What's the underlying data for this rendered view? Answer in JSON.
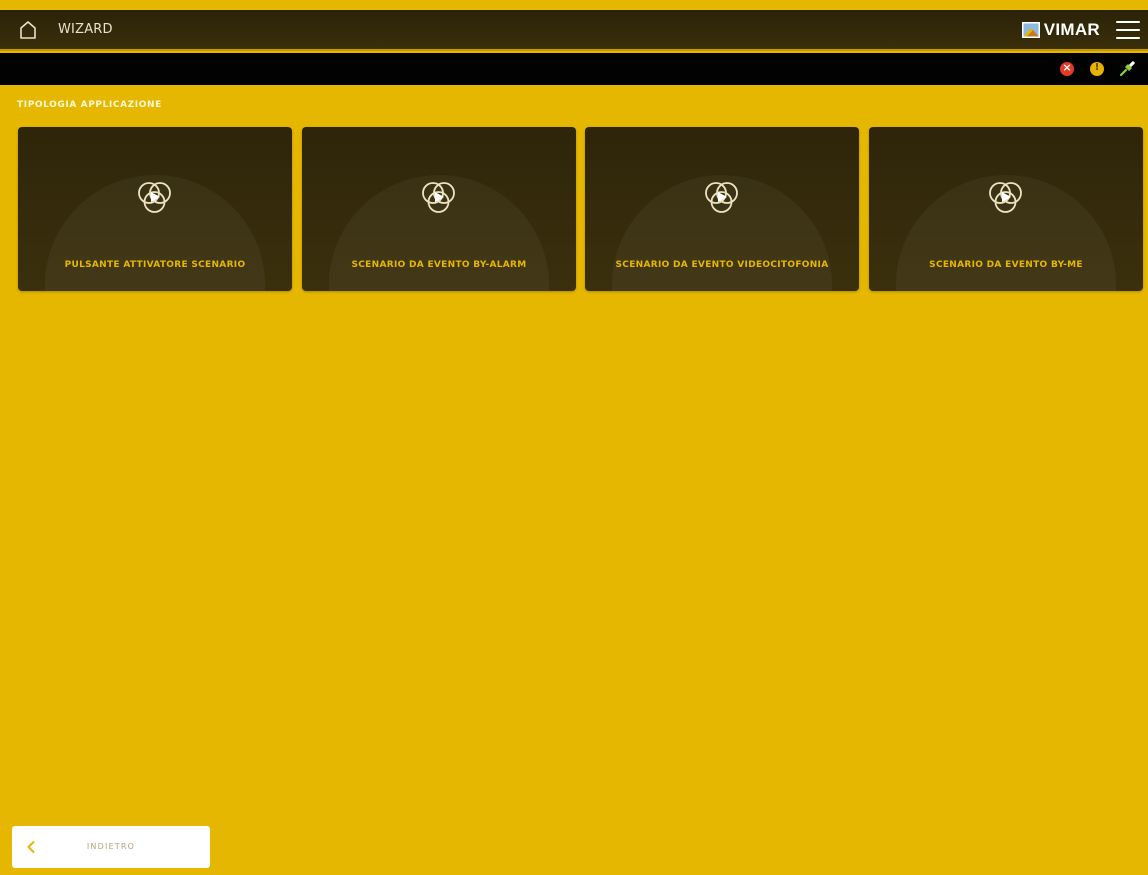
{
  "header": {
    "title": "WIZARD",
    "brand": "VIMAR",
    "home_icon": "home-icon",
    "menu_icon": "hamburger-menu-icon"
  },
  "status": {
    "error_icon": "error-icon",
    "warning_icon": "warning-icon",
    "connection_icon": "connection-plug-icon",
    "colors": {
      "error": "#e43b25",
      "warning": "#e5b400",
      "connection": "#8bd13b"
    }
  },
  "section": {
    "title": "TIPOLOGIA APPLICAZIONE"
  },
  "cards": [
    {
      "label": "PULSANTE ATTIVATORE SCENARIO",
      "icon": "scenario-play-icon"
    },
    {
      "label": "SCENARIO DA EVENTO BY-ALARM",
      "icon": "scenario-play-icon"
    },
    {
      "label": "SCENARIO DA EVENTO VIDEOCITOFONIA",
      "icon": "scenario-play-icon"
    },
    {
      "label": "SCENARIO DA EVENTO BY-ME",
      "icon": "scenario-play-icon"
    }
  ],
  "footer": {
    "back_label": "INDIETRO",
    "back_icon": "chevron-left-icon"
  },
  "colors": {
    "background": "#e5b700",
    "card_bg": "#332a0b",
    "accent": "#e5b700"
  }
}
